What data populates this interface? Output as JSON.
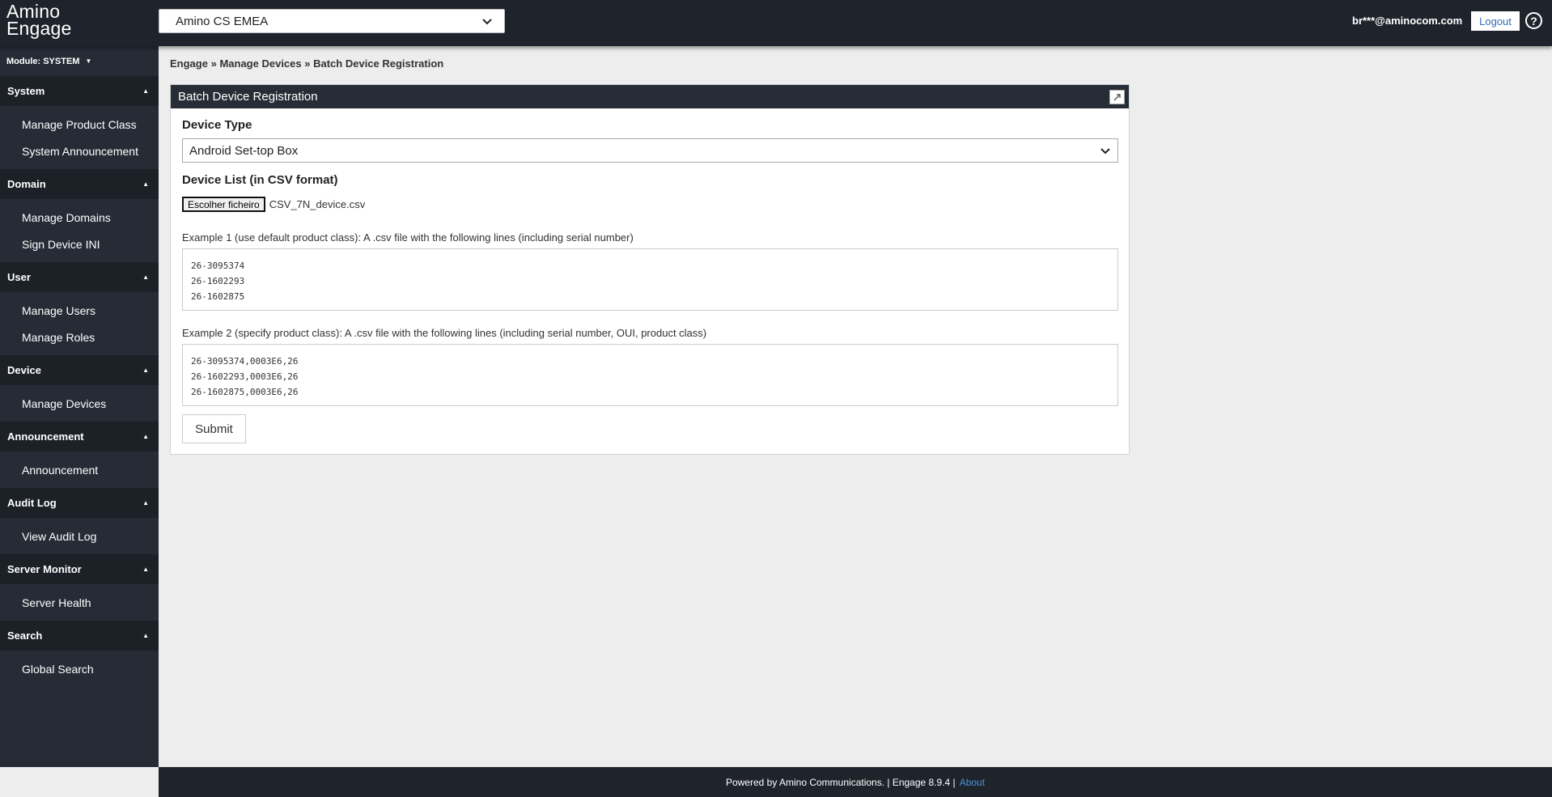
{
  "app": {
    "logo_line1": "Amino",
    "logo_line2": "Engage",
    "domain_selected": "Amino CS EMEA",
    "user_email": "br***@aminocom.com",
    "logout_label": "Logout",
    "help_glyph": "?"
  },
  "sidebar": {
    "module_label": "Module: SYSTEM",
    "sections": [
      {
        "title": "System",
        "items": [
          "Manage Product Class",
          "System Announcement"
        ]
      },
      {
        "title": "Domain",
        "items": [
          "Manage Domains",
          "Sign Device INI"
        ]
      },
      {
        "title": "User",
        "items": [
          "Manage Users",
          "Manage Roles"
        ]
      },
      {
        "title": "Device",
        "items": [
          "Manage Devices"
        ]
      },
      {
        "title": "Announcement",
        "items": [
          "Announcement"
        ]
      },
      {
        "title": "Audit Log",
        "items": [
          "View Audit Log"
        ]
      },
      {
        "title": "Server Monitor",
        "items": [
          "Server Health"
        ]
      },
      {
        "title": "Search",
        "items": [
          "Global Search"
        ]
      }
    ]
  },
  "breadcrumb": {
    "items": [
      "Engage",
      "Manage Devices",
      "Batch Device Registration"
    ],
    "separator": "»"
  },
  "panel": {
    "title": "Batch Device Registration",
    "device_type_label": "Device Type",
    "device_type_value": "Android Set-top Box",
    "device_list_label": "Device List (in CSV format)",
    "file_button_label": "Escolher ficheiro",
    "file_name": "CSV_7N_device.csv",
    "example1_label": "Example 1 (use default product class): A .csv file with the following lines (including serial number)",
    "example1_lines": [
      "26-3095374",
      "26-1602293",
      "26-1602875"
    ],
    "example2_label": "Example 2 (specify product class): A .csv file with the following lines (including serial number, OUI, product class)",
    "example2_lines": [
      "26-3095374,0003E6,26",
      "26-1602293,0003E6,26",
      "26-1602875,0003E6,26"
    ],
    "submit_label": "Submit"
  },
  "footer": {
    "text": "Powered by Amino Communications. | Engage 8.9.4 |",
    "about_label": "About"
  },
  "colors": {
    "topbar_bg": "#1f242c",
    "sidebar_bg": "#262c36",
    "section_header_bg": "#1c2027",
    "link_blue": "#2f6fb8"
  },
  "icons": {
    "select_chevron": "chevron-down-icon",
    "section_toggle": "caret-up-icon",
    "panel_expand": "expand-icon",
    "help": "help-icon"
  }
}
